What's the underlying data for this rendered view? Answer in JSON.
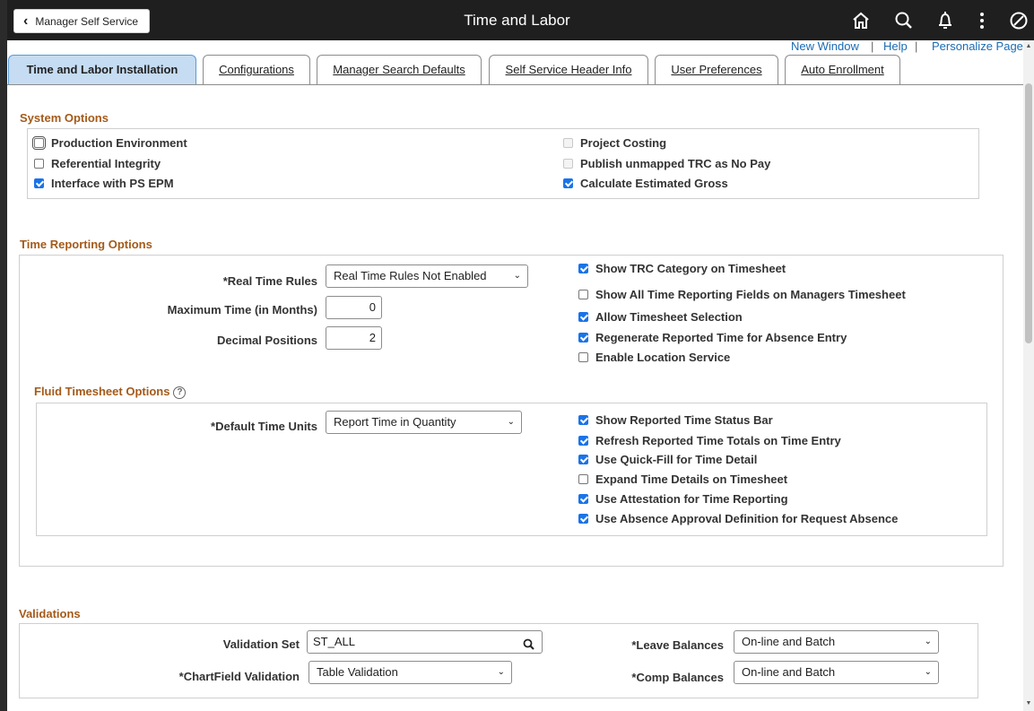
{
  "header": {
    "back_label": "Manager Self Service",
    "title": "Time and Labor"
  },
  "links": {
    "new_window": "New Window",
    "help": "Help",
    "personalize": "Personalize Page",
    "separator": "|"
  },
  "tabs": [
    {
      "label": "Time and Labor Installation",
      "active": true
    },
    {
      "label": "Configurations"
    },
    {
      "label": "Manager Search Defaults"
    },
    {
      "label": "Self Service Header Info"
    },
    {
      "label": "User Preferences"
    },
    {
      "label": "Auto Enrollment"
    }
  ],
  "system_options": {
    "title": "System Options",
    "left": [
      {
        "label": "Production Environment",
        "checked": false
      },
      {
        "label": "Referential Integrity",
        "checked": false
      },
      {
        "label": "Interface with PS EPM",
        "checked": true
      }
    ],
    "right": [
      {
        "label": "Project Costing",
        "checked": false,
        "disabled": true
      },
      {
        "label": "Publish unmapped TRC as No Pay",
        "checked": false,
        "disabled": true
      },
      {
        "label": "Calculate Estimated Gross",
        "checked": true
      }
    ]
  },
  "time_reporting": {
    "title": "Time Reporting Options",
    "real_time_rules_label": "*Real Time Rules",
    "real_time_rules_value": "Real Time Rules Not Enabled",
    "max_time_label": "Maximum Time (in Months)",
    "max_time_value": "0",
    "decimal_label": "Decimal Positions",
    "decimal_value": "2",
    "checks": [
      {
        "label": "Show TRC Category on Timesheet",
        "checked": true
      },
      {
        "label": "Show All Time Reporting Fields on Managers Timesheet",
        "checked": false
      },
      {
        "label": "Allow Timesheet Selection",
        "checked": true
      },
      {
        "label": "Regenerate Reported Time for Absence Entry",
        "checked": true
      },
      {
        "label": "Enable Location Service",
        "checked": false
      }
    ]
  },
  "fluid": {
    "title": "Fluid Timesheet Options",
    "help_glyph": "?",
    "default_units_label": "*Default Time Units",
    "default_units_value": "Report Time in Quantity",
    "checks": [
      {
        "label": "Show Reported Time Status Bar",
        "checked": true
      },
      {
        "label": "Refresh Reported Time Totals on Time Entry",
        "checked": true
      },
      {
        "label": "Use Quick-Fill for Time Detail",
        "checked": true
      },
      {
        "label": "Expand Time Details on Timesheet",
        "checked": false
      },
      {
        "label": "Use Attestation for Time Reporting",
        "checked": true
      },
      {
        "label": "Use Absence Approval Definition for Request Absence",
        "checked": true
      }
    ]
  },
  "validations": {
    "title": "Validations",
    "validation_set_label": "Validation Set",
    "validation_set_value": "ST_ALL",
    "chartfield_label": "*ChartField Validation",
    "chartfield_value": "Table Validation",
    "leave_label": "*Leave Balances",
    "leave_value": "On-line and Batch",
    "comp_label": "*Comp Balances",
    "comp_value": "On-line and Batch"
  }
}
